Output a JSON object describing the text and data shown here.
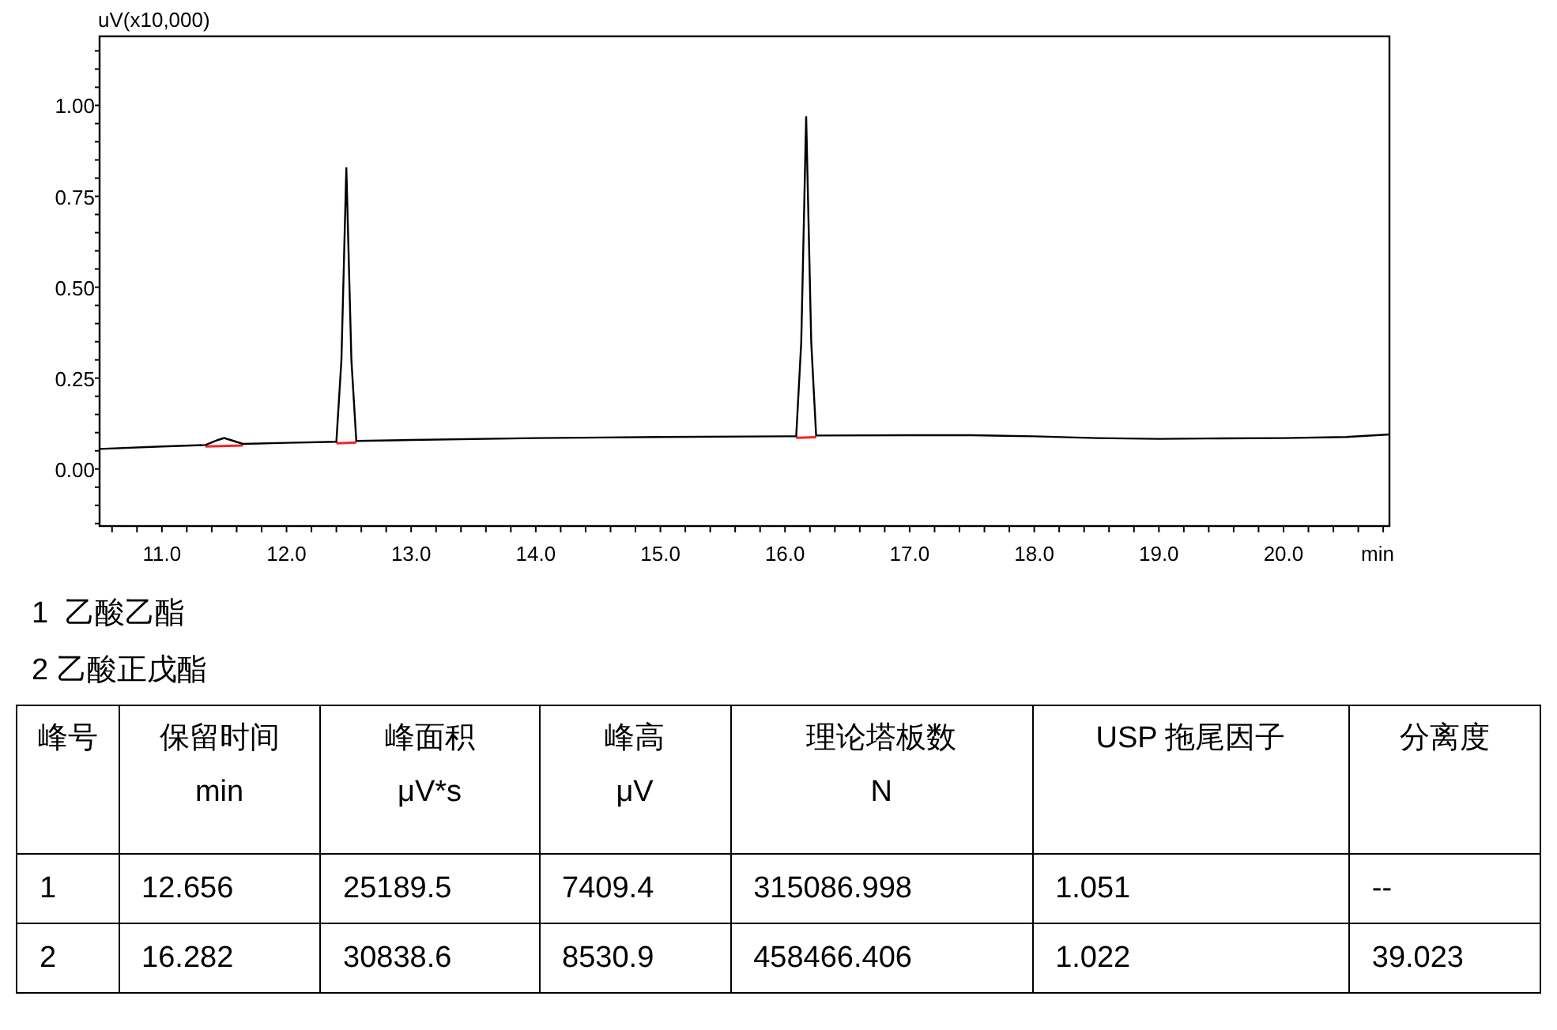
{
  "chromatogram": {
    "chart_data": {
      "type": "line",
      "xlabel": "min",
      "ylabel": "uV(x10,000)",
      "xlim": [
        10.5,
        20.85
      ],
      "ylim": [
        -0.157,
        1.19
      ],
      "xticks": [
        {
          "value": 11,
          "label": "11.0"
        },
        {
          "value": 12,
          "label": "12.0"
        },
        {
          "value": 13,
          "label": "13.0"
        },
        {
          "value": 14,
          "label": "14.0"
        },
        {
          "value": 15,
          "label": "15.0"
        },
        {
          "value": 16,
          "label": "16.0"
        },
        {
          "value": 17,
          "label": "17.0"
        },
        {
          "value": 18,
          "label": "18.0"
        },
        {
          "value": 19,
          "label": "19.0"
        },
        {
          "value": 20,
          "label": "20.0"
        }
      ],
      "yticks": [
        {
          "value": 0,
          "label": "0.00"
        },
        {
          "value": 0.25,
          "label": "0.25"
        },
        {
          "value": 0.5,
          "label": "0.50"
        },
        {
          "value": 0.75,
          "label": "0.75"
        },
        {
          "value": 1,
          "label": "1.00"
        }
      ],
      "x": [
        10.5,
        11.0,
        11.35,
        11.45,
        11.5,
        11.55,
        11.65,
        12.0,
        12.4,
        12.44,
        12.48,
        12.52,
        12.56,
        13.0,
        14.0,
        15.0,
        16.0,
        16.09,
        16.13,
        16.17,
        16.21,
        16.25,
        17.0,
        17.5,
        18.0,
        18.5,
        19.0,
        19.5,
        20.0,
        20.5,
        20.85
      ],
      "series": [
        {
          "color": "#000000",
          "values": [
            0.055,
            0.062,
            0.066,
            0.08,
            0.085,
            0.08,
            0.069,
            0.072,
            0.075,
            0.3,
            0.83,
            0.3,
            0.077,
            0.08,
            0.085,
            0.088,
            0.09,
            0.09,
            0.35,
            0.97,
            0.35,
            0.092,
            0.093,
            0.093,
            0.09,
            0.085,
            0.083,
            0.084,
            0.085,
            0.088,
            0.095
          ]
        }
      ]
    }
  },
  "legend": [
    "1  乙酸乙酯",
    "2 乙酸正戊酯"
  ],
  "table": {
    "columns": [
      {
        "title": "峰号"
      },
      {
        "title": "保留时间",
        "unit": "min"
      },
      {
        "title": "峰面积",
        "unit": "μV*s"
      },
      {
        "title": "峰高",
        "unit": "μV"
      },
      {
        "title": "理论塔板数",
        "unit": "N"
      },
      {
        "title": "USP 拖尾因子"
      },
      {
        "title": "分离度"
      }
    ],
    "rows": [
      [
        "1",
        "12.656",
        "25189.5",
        "7409.4",
        "315086.998",
        "1.051",
        "--"
      ],
      [
        "2",
        "16.282",
        "30838.6",
        "8530.9",
        "458466.406",
        "1.022",
        "39.023"
      ]
    ]
  }
}
